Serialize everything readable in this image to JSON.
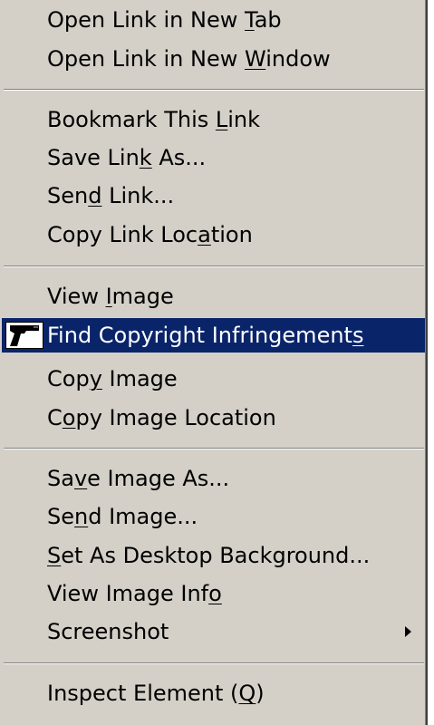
{
  "menu": {
    "items": [
      {
        "id": "open-new-tab",
        "pre": "Open Link in New ",
        "key": "T",
        "post": "ab"
      },
      {
        "id": "open-new-window",
        "pre": "Open Link in New ",
        "key": "W",
        "post": "indow"
      },
      {
        "id": "bookmark-link",
        "pre": "Bookmark This ",
        "key": "L",
        "post": "ink"
      },
      {
        "id": "save-link-as",
        "pre": "Save Lin",
        "key": "k",
        "post": " As..."
      },
      {
        "id": "send-link",
        "pre": "Sen",
        "key": "d",
        "post": " Link..."
      },
      {
        "id": "copy-link-location",
        "pre": "Copy Link Loc",
        "key": "a",
        "post": "tion"
      },
      {
        "id": "view-image",
        "pre": "View ",
        "key": "I",
        "post": "mage"
      },
      {
        "id": "find-copyright",
        "pre": "Find Copyright Infringement",
        "key": "s",
        "post": ""
      },
      {
        "id": "copy-image",
        "pre": "Cop",
        "key": "y",
        "post": " Image"
      },
      {
        "id": "copy-image-location",
        "pre": "C",
        "key": "o",
        "post": "py Image Location"
      },
      {
        "id": "save-image-as",
        "pre": "Sa",
        "key": "v",
        "post": "e Image As..."
      },
      {
        "id": "send-image",
        "pre": "Se",
        "key": "n",
        "post": "d Image..."
      },
      {
        "id": "set-desktop-bg",
        "pre": "",
        "key": "S",
        "post": "et As Desktop Background..."
      },
      {
        "id": "view-image-info",
        "pre": "View Image Inf",
        "key": "o",
        "post": ""
      },
      {
        "id": "screenshot",
        "pre": "Screenshot",
        "key": "",
        "post": ""
      },
      {
        "id": "inspect-element",
        "pre": "Inspect Element (",
        "key": "Q",
        "post": ")"
      }
    ],
    "highlighted_item": "find-copyright",
    "submenu_item": "screenshot",
    "icon_item": "find-copyright",
    "icon_name": "gun-icon"
  },
  "colors": {
    "menu_background": "#d4d0c8",
    "highlight_background": "#0a246a",
    "highlight_text": "#ffffff",
    "text": "#000000"
  }
}
